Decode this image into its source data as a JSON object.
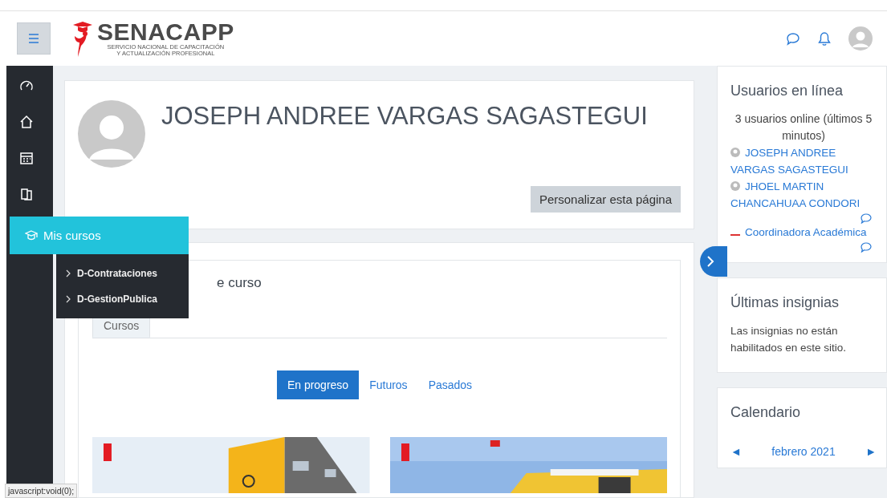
{
  "header": {
    "logo": {
      "name": "SENACAPP",
      "tagline": [
        "SERVICIO NACIONAL DE CAPACITACIÓN",
        "Y ACTUALIZACIÓN PROFESIONAL"
      ]
    }
  },
  "flyout": {
    "title": "Mis cursos",
    "items": [
      "D-Contrataciones",
      "D-GestionPublica"
    ]
  },
  "profile": {
    "name": "JOSEPH ANDREE VARGAS SAGASTEGUI",
    "button": "Personalizar esta página"
  },
  "course_overview": {
    "title": "e curso",
    "tabs": [
      {
        "label": "Cursos",
        "selected": true
      }
    ],
    "filters": [
      {
        "label": "En progreso",
        "selected": true
      },
      {
        "label": "Futuros",
        "selected": false
      },
      {
        "label": "Pasados",
        "selected": false
      }
    ]
  },
  "online_users": {
    "title": "Usuarios en línea",
    "summary": "3 usuarios online (últimos 5 minutos)",
    "users": [
      {
        "name": "JOSEPH ANDREE VARGAS SAGASTEGUI",
        "kind": "person",
        "message": false
      },
      {
        "name": "JHOEL MARTIN CHANCAHUAA CONDORI",
        "kind": "person",
        "message": true
      },
      {
        "name": "Coordinadora Académica",
        "kind": "logo",
        "message": true
      }
    ]
  },
  "badges": {
    "title": "Últimas insignias",
    "text": "Las insignias no están habilitados en este sitio."
  },
  "calendar": {
    "title": "Calendario",
    "prev": "◄",
    "month": "febrero 2021",
    "next": "►"
  },
  "status_bar": "javascript:void(0);"
}
